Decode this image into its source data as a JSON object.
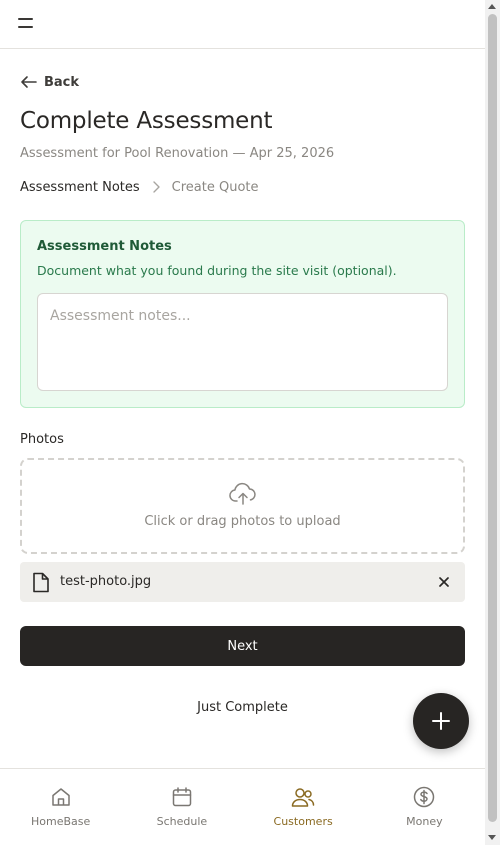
{
  "header": {
    "menu_icon": "menu-icon"
  },
  "back": {
    "label": "Back",
    "icon": "arrow-left-icon"
  },
  "page": {
    "title": "Complete Assessment",
    "subtitle": "Assessment for Pool Renovation — Apr 25, 2026"
  },
  "steps": {
    "active": "Assessment Notes",
    "next": "Create Quote",
    "separator_icon": "chevron-right-icon"
  },
  "notes": {
    "title": "Assessment Notes",
    "description": "Document what you found during the site visit (optional).",
    "value": "",
    "placeholder": "Assessment notes...",
    "accent_bg": "#ecfbf0",
    "accent_border": "#b9ecc8",
    "title_color": "#1f5a37"
  },
  "photos": {
    "label": "Photos",
    "upload_text": "Click or drag photos to upload",
    "upload_icon": "cloud-upload-icon",
    "files": [
      {
        "name": "test-photo.jpg",
        "icon": "file-icon",
        "remove_icon": "close-icon"
      }
    ]
  },
  "actions": {
    "next_label": "Next",
    "just_complete_label": "Just Complete",
    "fab_icon": "plus-icon"
  },
  "nav": {
    "items": [
      {
        "label": "HomeBase",
        "icon": "home-icon",
        "active": false
      },
      {
        "label": "Schedule",
        "icon": "calendar-icon",
        "active": false
      },
      {
        "label": "Customers",
        "icon": "users-icon",
        "active": true
      },
      {
        "label": "Money",
        "icon": "dollar-icon",
        "active": false
      }
    ],
    "active_color": "#8a6a22"
  },
  "scrollbar": {
    "position": 0
  }
}
